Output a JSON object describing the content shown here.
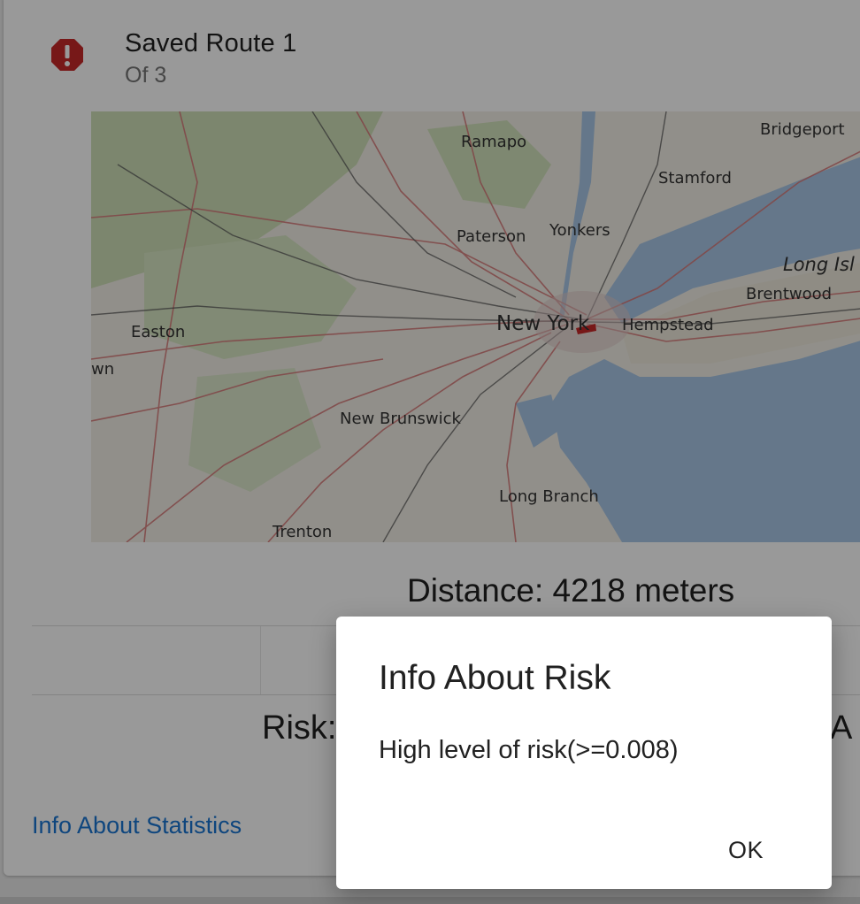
{
  "card": {
    "icon": "alert-octagon-icon",
    "title": "Saved Route 1",
    "subtitle": "Of 3",
    "distance": "Distance: 4218 meters",
    "risk_label": "Risk:",
    "risk_right_partial": "A",
    "stats_link": "Info About Statistics",
    "colors": {
      "icon": "#c62828",
      "link": "#1976d2",
      "route": "#c62828"
    }
  },
  "map": {
    "places": [
      "Ramapo",
      "Bridgeport",
      "Stamford",
      "Paterson",
      "Yonkers",
      "Long Isl",
      "Brentwood",
      "New York",
      "Hempstead",
      "Easton",
      "wn",
      "New Brunswick",
      "Long Branch",
      "Trenton"
    ]
  },
  "dialog": {
    "title": "Info About Risk",
    "body": "High level of risk(>=0.008)",
    "ok_label": "OK"
  }
}
